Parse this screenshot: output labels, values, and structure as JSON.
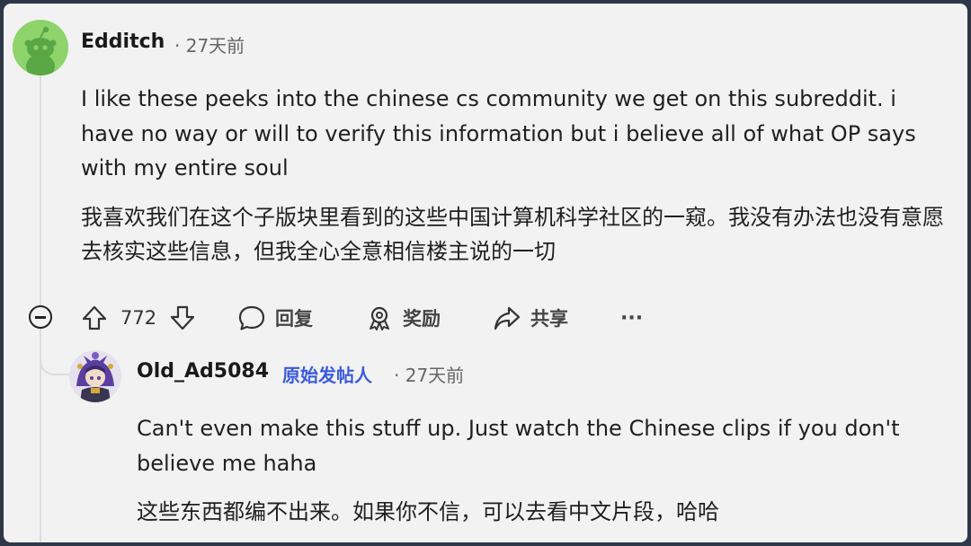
{
  "comment": {
    "author": "Edditch",
    "time": "27天前",
    "body_en": "I like these peeks into the chinese cs community we get on this subreddit. i have no way or will to verify this information but i believe all of what OP says with my entire soul",
    "body_cn": "我喜欢我们在这个子版块里看到的这些中国计算机科学社区的一窥。我没有办法也没有意愿去核实这些信息，但我全心全意相信楼主说的一切"
  },
  "actions": {
    "vote_count": "772",
    "reply_label": "回复",
    "award_label": "奖励",
    "share_label": "共享",
    "more_label": "···"
  },
  "reply": {
    "author": "Old_Ad5084",
    "badge": "原始发帖人",
    "time": "27天前",
    "body_en": "Can't even make this stuff up. Just watch the Chinese clips if you don't believe me haha",
    "body_cn": "这些东西都编不出来。如果你不信，可以去看中文片段，哈哈"
  },
  "icons": {
    "avatar1": "snoo-avatar-green",
    "avatar2": "anime-character-avatar",
    "collapse": "collapse-minus-icon",
    "upvote": "upvote-arrow-icon",
    "downvote": "downvote-arrow-icon",
    "reply": "speech-bubble-icon",
    "award": "award-icon",
    "share": "share-arrow-icon"
  },
  "colors": {
    "background": "#f2f2f2",
    "op_badge": "#3a5bd9",
    "frame": "#2d3748"
  }
}
